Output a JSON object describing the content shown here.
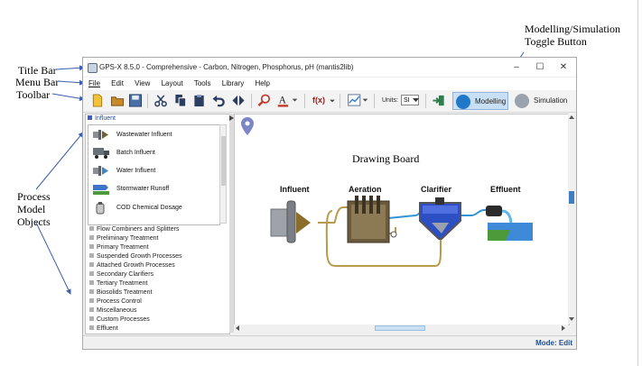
{
  "annotations": {
    "title_bar": "Title Bar",
    "menu_bar": "Menu Bar",
    "toolbar": "Toolbar",
    "process_model_objects": "Process Model Objects",
    "toggle_button": "Modelling/Simulation Toggle Button",
    "drawing_board": "Drawing Board"
  },
  "window": {
    "title": "GPS-X 8.5.0  - Comprehensive - Carbon, Nitrogen, Phosphorus, pH (mantis2lib)",
    "minimize": "–",
    "maximize": "☐",
    "close": "✕"
  },
  "menu": [
    "File",
    "Edit",
    "View",
    "Layout",
    "Tools",
    "Library",
    "Help"
  ],
  "toolbar": {
    "fx_label": "f(x)",
    "units_label": "Units:",
    "units_value": "SI",
    "modelling_label": "Modelling",
    "simulation_label": "Simulation"
  },
  "sidebar": {
    "header": "Influent",
    "objects": [
      {
        "label": "Wastewater Influent",
        "icon": "pipe-icon"
      },
      {
        "label": "Batch Influent",
        "icon": "truck-icon"
      },
      {
        "label": "Water Influent",
        "icon": "water-pipe-icon"
      },
      {
        "label": "Stormwater Runoff",
        "icon": "runoff-icon"
      },
      {
        "label": "COD Chemical Dosage",
        "icon": "dosage-tank-icon"
      }
    ],
    "categories": [
      "Flow Combiners and Splitters",
      "Preliminary Treatment",
      "Primary Treatment",
      "Suspended Growth Processes",
      "Attached Growth Processes",
      "Secondary Clarifiers",
      "Tertiary Treatment",
      "Biosolids Treatment",
      "Process Control",
      "Miscellaneous",
      "Custom Processes",
      "Effluent"
    ]
  },
  "board": {
    "processes": [
      "Influent",
      "Aeration",
      "Clarifier",
      "Effluent"
    ]
  },
  "status": {
    "mode": "Mode: Edit"
  },
  "colors": {
    "modelling_active": "#c9dff3",
    "modelling_icon": "#1f78c8",
    "sludge_line": "#b89a4c",
    "water_line": "#2f93d6",
    "status_mode": "#1f4e8c"
  }
}
